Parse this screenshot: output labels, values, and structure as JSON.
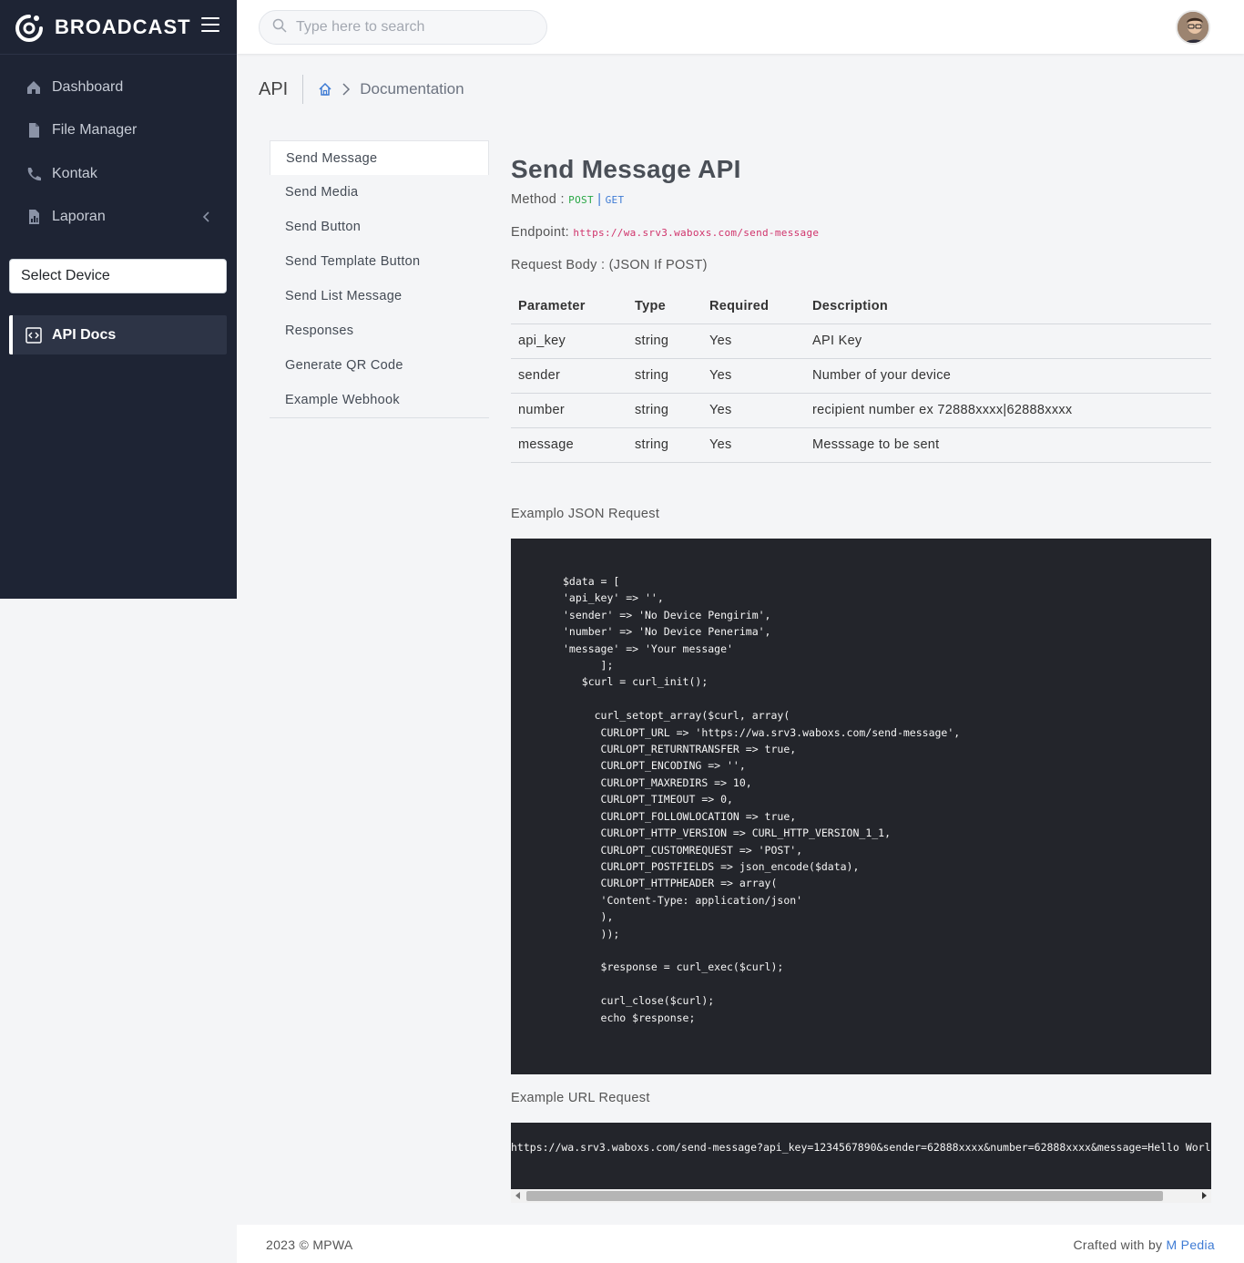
{
  "brand": {
    "name": "BROADCAST"
  },
  "sidebar": {
    "items": [
      {
        "label": "Dashboard",
        "icon": "home-icon"
      },
      {
        "label": "File Manager",
        "icon": "file-icon"
      },
      {
        "label": "Kontak",
        "icon": "phone-icon"
      },
      {
        "label": "Laporan",
        "icon": "report-icon"
      }
    ],
    "device_select": "Select Device",
    "api_docs_label": "API Docs"
  },
  "search": {
    "placeholder": "Type here to search"
  },
  "page": {
    "title": "API",
    "breadcrumb_current": "Documentation"
  },
  "doc_menu": [
    "Send Message",
    "Send Media",
    "Send Button",
    "Send Template Button",
    "Send List Message",
    "Responses",
    "Generate QR Code",
    "Example Webhook"
  ],
  "content": {
    "heading": "Send Message API",
    "method_label": "Method :",
    "method_post": "POST",
    "method_sep": " | ",
    "method_get": "GET",
    "endpoint_label": "Endpoint:",
    "endpoint_url": "https://wa.srv3.waboxs.com/send-message",
    "request_body_label": "Request Body : (JSON If POST)",
    "table": {
      "headers": [
        "Parameter",
        "Type",
        "Required",
        "Description"
      ],
      "rows": [
        [
          "api_key",
          "string",
          "Yes",
          "API Key"
        ],
        [
          "sender",
          "string",
          "Yes",
          "Number of your device"
        ],
        [
          "number",
          "string",
          "Yes",
          "recipient number ex 72888xxxx|62888xxxx"
        ],
        [
          "message",
          "string",
          "Yes",
          "Messsage to be sent"
        ]
      ]
    },
    "json_example_label": "Examplo JSON Request",
    "json_example_code": "$data = [\n'api_key' => '',\n'sender' => 'No Device Pengirim',\n'number' => 'No Device Penerima',\n'message' => 'Your message'\n      ];\n   $curl = curl_init();\n\n     curl_setopt_array($curl, array(\n      CURLOPT_URL => 'https://wa.srv3.waboxs.com/send-message',\n      CURLOPT_RETURNTRANSFER => true,\n      CURLOPT_ENCODING => '',\n      CURLOPT_MAXREDIRS => 10,\n      CURLOPT_TIMEOUT => 0,\n      CURLOPT_FOLLOWLOCATION => true,\n      CURLOPT_HTTP_VERSION => CURL_HTTP_VERSION_1_1,\n      CURLOPT_CUSTOMREQUEST => 'POST',\n      CURLOPT_POSTFIELDS => json_encode($data),\n      CURLOPT_HTTPHEADER => array(\n      'Content-Type: application/json'\n      ),\n      ));\n\n      $response = curl_exec($curl);\n\n      curl_close($curl);\n      echo $response;",
    "url_example_label": "Example URL Request",
    "url_example": "https://wa.srv3.waboxs.com/send-message?api_key=1234567890&sender=62888xxxx&number=62888xxxx&message=Hello World"
  },
  "footer": {
    "copyright": "2023 © MPWA",
    "crafted_prefix": "Crafted with by ",
    "crafted_link": "M Pedia"
  },
  "colors": {
    "sidebar_bg": "#1e2434",
    "code_bg": "#23252b",
    "accent_blue": "#3e7bd4",
    "post_green": "#28a745",
    "endpoint_pink": "#d0336b"
  }
}
